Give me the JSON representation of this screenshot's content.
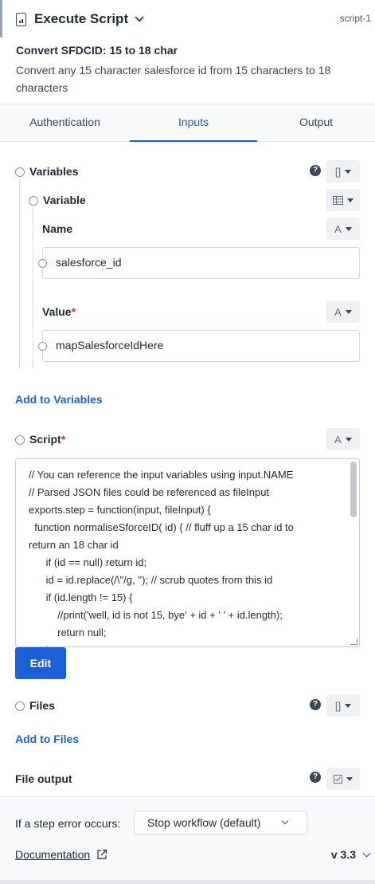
{
  "header": {
    "title": "Execute Script",
    "script_id": "script-1",
    "step_name": "Convert SFDCID: 15 to 18 char",
    "step_description": "Convert any 15 character salesforce id from 15 characters to 18 characters"
  },
  "tabs": [
    {
      "label": "Authentication",
      "active": false
    },
    {
      "label": "Inputs",
      "active": true
    },
    {
      "label": "Output",
      "active": false
    }
  ],
  "inputs": {
    "variables": {
      "label": "Variables",
      "type_icon": "[]",
      "help_icon": "?",
      "variable": {
        "label": "Variable",
        "type_icon": "table-icon",
        "name": {
          "label": "Name",
          "type_icon": "A",
          "value": "salesforce_id"
        },
        "value": {
          "label": "Value",
          "required_mark": "*",
          "type_icon": "A",
          "value": "mapSalesforceIdHere"
        }
      },
      "add_label": "Add to Variables"
    },
    "script": {
      "label": "Script",
      "required_mark": "*",
      "type_icon": "A",
      "code_lines": [
        "// You can reference the input variables using input.NAME",
        "// Parsed JSON files could be referenced as fileInput",
        "exports.step = function(input, fileInput) {",
        "  function normaliseSforceID( id) { // fluff up a 15 char id to",
        "return an 18 char id",
        "      if (id == null) return id;",
        "      id = id.replace(/\\\"/g, ''); // scrub quotes from this id",
        "      if (id.length != 15) {",
        "          //print('well, id is not 15, bye' + id + ' ' + id.length);",
        "          return null;",
        "      }"
      ],
      "edit_label": "Edit"
    },
    "files": {
      "label": "Files",
      "type_icon": "[]",
      "help_icon": "?",
      "add_label": "Add to Files"
    },
    "file_output": {
      "label": "File output",
      "help_icon": "?",
      "type_icon": "checkbox-icon"
    }
  },
  "footer": {
    "error_label": "If a step error occurs:",
    "error_option": "Stop workflow (default)",
    "documentation_label": "Documentation",
    "version": "v 3.3"
  },
  "colors": {
    "accent": "#1d5fd6",
    "required": "#d0342c"
  }
}
